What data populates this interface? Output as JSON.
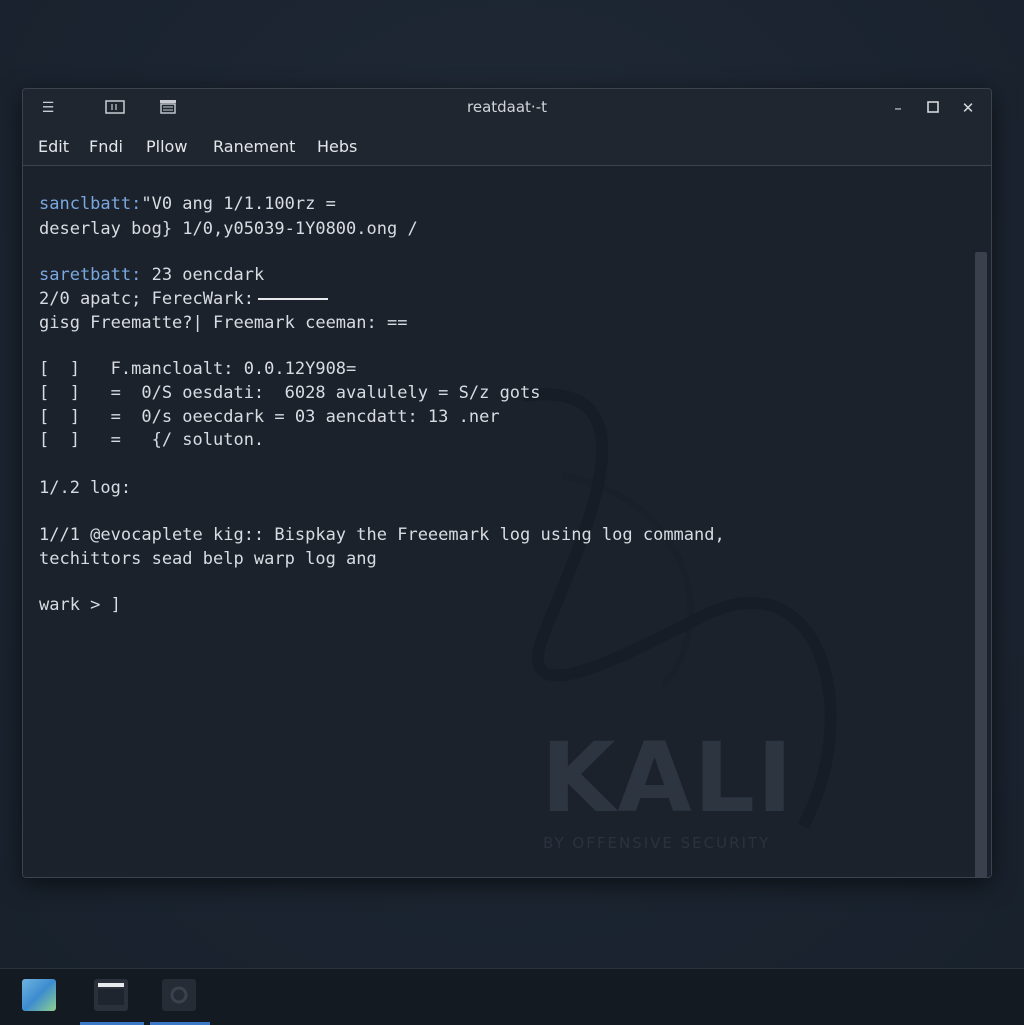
{
  "window": {
    "title": "reatdaat·-t",
    "menu": [
      "Edit",
      "Fndi",
      "Pllow",
      "Ranement",
      "Hebs"
    ]
  },
  "terminal": {
    "lines": [
      {
        "prompt": "sanclbatt:",
        "text": "\"V0 ang 1/1.100rz ="
      },
      {
        "prompt": "",
        "text": "deserlay bog} 1/0,y05039-1Y0800.ong /"
      },
      {
        "prompt": "saretbatt:",
        "text": " 23 oencdark"
      },
      {
        "prompt": "",
        "text": "2/0 apatc; FerecWark:"
      },
      {
        "prompt": "",
        "text": "gisg Freematte?| Freemark ceeman: =="
      },
      {
        "prompt": "",
        "text": "[  ]   F.mancloalt: 0.0.12Y908="
      },
      {
        "prompt": "",
        "text": "[  ]   =  0/S oesdati:  6028 avalulely = S/z gots"
      },
      {
        "prompt": "",
        "text": "[  ]   =  0/s oeecdark = 03 aencdatt: 13 .ner"
      },
      {
        "prompt": "",
        "text": "[  ]   =   {/ soluton."
      },
      {
        "prompt": "",
        "text": "1/.2 log:"
      },
      {
        "prompt": "",
        "text": "1//1 @evocaplete kig:: Bispkay the Freeemark log using log command,"
      },
      {
        "prompt": "",
        "text": "techittors sead belp warp log ang"
      },
      {
        "prompt": "",
        "text": "wark > ]"
      }
    ]
  },
  "watermark": {
    "logo_text": "KALI",
    "subtitle": "BY OFFENSIVE SECURITY"
  },
  "colors": {
    "background": "#1b2430",
    "window": "#1c222c",
    "prompt": "#79a8e0",
    "text": "#d8dce2"
  },
  "icons": {
    "hamburger": "hamburger-menu-icon",
    "new_tab": "new-tab-icon",
    "split": "split-view-icon",
    "minimize": "minimize-icon",
    "maximize": "maximize-icon",
    "close": "close-icon"
  }
}
